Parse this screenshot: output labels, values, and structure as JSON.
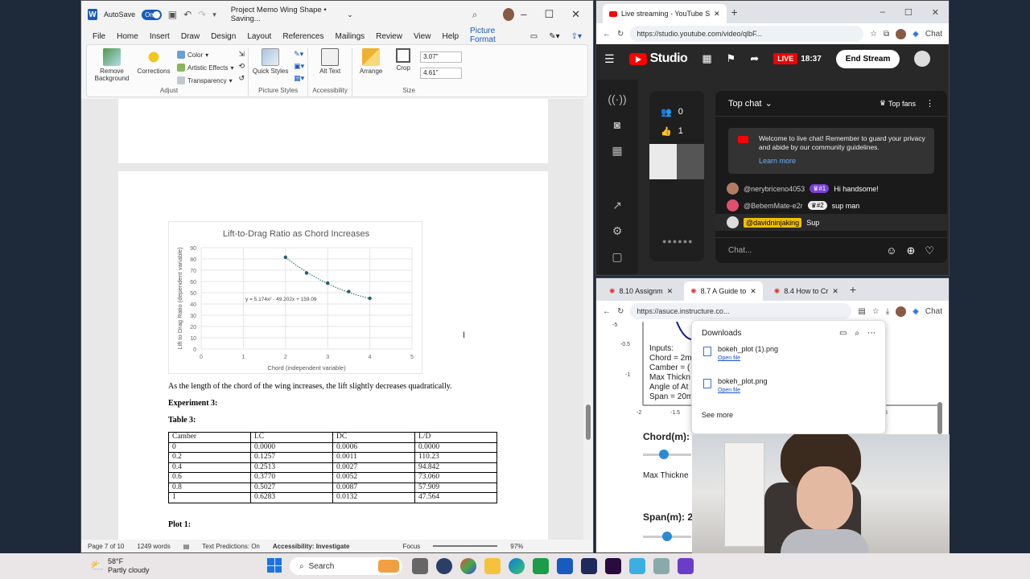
{
  "word": {
    "autosave_label": "AutoSave",
    "autosave_state": "On",
    "title": "Project Memo Wing Shape • Saving... ",
    "menu": [
      "File",
      "Home",
      "Insert",
      "Draw",
      "Design",
      "Layout",
      "References",
      "Mailings",
      "Review",
      "View",
      "Help",
      "Picture Format"
    ],
    "ribbon": {
      "remove_bg": "Remove Background",
      "corrections": "Corrections",
      "color": "Color",
      "artistic": "Artistic Effects",
      "transparency": "Transparency",
      "adjust_label": "Adjust",
      "quick_styles": "Quick Styles",
      "picture_styles_label": "Picture Styles",
      "alt_text": "Alt Text",
      "accessibility_label": "Accessibility",
      "arrange": "Arrange",
      "crop": "Crop",
      "height": "3.07\"",
      "width": "4.61\"",
      "size_label": "Size"
    },
    "doc": {
      "conclusion": "As the length of the chord of the wing increases, the lift slightly decreases quadratically.",
      "experiment": "Experiment 3:",
      "table_title": "Table 3:",
      "table": {
        "headers": [
          "Camber",
          "LC",
          "DC",
          "L/D"
        ],
        "rows": [
          [
            "0",
            "0.0000",
            "0.0006",
            "0.0000"
          ],
          [
            "0.2",
            "0.1257",
            "0.0011",
            "110.23"
          ],
          [
            "0.4",
            "0.2513",
            "0.0027",
            "94.842"
          ],
          [
            "0.6",
            "0.3770",
            "0.0052",
            "73.060"
          ],
          [
            "0.8",
            "0.5027",
            "0.0087",
            "57.909"
          ],
          [
            "1",
            "0.6283",
            "0.0132",
            "47.564"
          ]
        ]
      },
      "plot_label": "Plot 1:"
    },
    "status": {
      "page": "Page 7 of 10",
      "words": "1249 words",
      "predictions": "Text Predictions: On",
      "accessibility": "Accessibility: Investigate",
      "focus": "Focus",
      "zoom": "97%"
    }
  },
  "chart_data": {
    "type": "scatter",
    "title": "Lift-to-Drag Ratio as Chord Increases",
    "xlabel": "Chord (independent variable)",
    "ylabel": "Lift to Drag Ratio (dependent variable)",
    "x": [
      2,
      2.5,
      3,
      3.5,
      4
    ],
    "y": [
      81.5,
      67.5,
      58.5,
      51,
      45
    ],
    "xlim": [
      0,
      5
    ],
    "ylim": [
      0,
      90
    ],
    "xticks": [
      "0",
      "1",
      "2",
      "3",
      "4",
      "5"
    ],
    "yticks": [
      "0",
      "10",
      "20",
      "30",
      "40",
      "50",
      "60",
      "70",
      "80",
      "90"
    ],
    "trendline_label": "y = 5.174x² - 49.202x + 159.09",
    "trendline": {
      "a": 5.174,
      "b": -49.202,
      "c": 159.09
    },
    "grid": true,
    "color": "#1f5f6b"
  },
  "yt": {
    "tab_title": "Live streaming - YouTube Stu",
    "url": "https://studio.youtube.com/video/qlbF...",
    "chat_label": "Chat",
    "studio": "Studio",
    "live": "LIVE",
    "timer": "18:37",
    "end_stream": "End Stream",
    "viewers": "0",
    "likes": "1",
    "top_chat": "Top chat",
    "top_fans": "Top fans",
    "welcome": "Welcome to live chat! Remember to guard your privacy and abide by our community guidelines.",
    "learn_more": "Learn more",
    "messages": [
      {
        "name": "@nerybriceno4053",
        "badge": "#1",
        "text": "Hi handsome!"
      },
      {
        "name": "@BebemMate-e2r",
        "badge": "#2",
        "text": "sup man"
      },
      {
        "name": "@davidninjaking",
        "badge": "",
        "text": "Sup"
      }
    ],
    "chat_placeholder": "Chat..."
  },
  "canvas": {
    "tabs": [
      "8.10 Assignm",
      "8.7 A Guide to",
      "8.4 How to Cr"
    ],
    "url": "https://asuce.instructure.co...",
    "chat_label": "Chat",
    "downloads_title": "Downloads",
    "files": [
      {
        "name": "bokeh_plot (1).png",
        "action": "Open file"
      },
      {
        "name": "bokeh_plot.png",
        "action": "Open file"
      }
    ],
    "see_more": "See more",
    "inputs_lines": [
      "Inputs:",
      "Chord = 2m",
      "Camber = (",
      "Max Thickn",
      "Angle of At",
      "Span = 20m"
    ],
    "axis_ticks": [
      "-5",
      "-0.5",
      "-1",
      "-1.5",
      "-2",
      "-1.5",
      "5"
    ],
    "slider_chord": "Chord(m):",
    "slider_thick": "Max Thickne",
    "slider_span": "Span(m): 2"
  },
  "taskbar": {
    "temp": "58°F",
    "weather": "Partly cloudy",
    "search": "Search"
  }
}
